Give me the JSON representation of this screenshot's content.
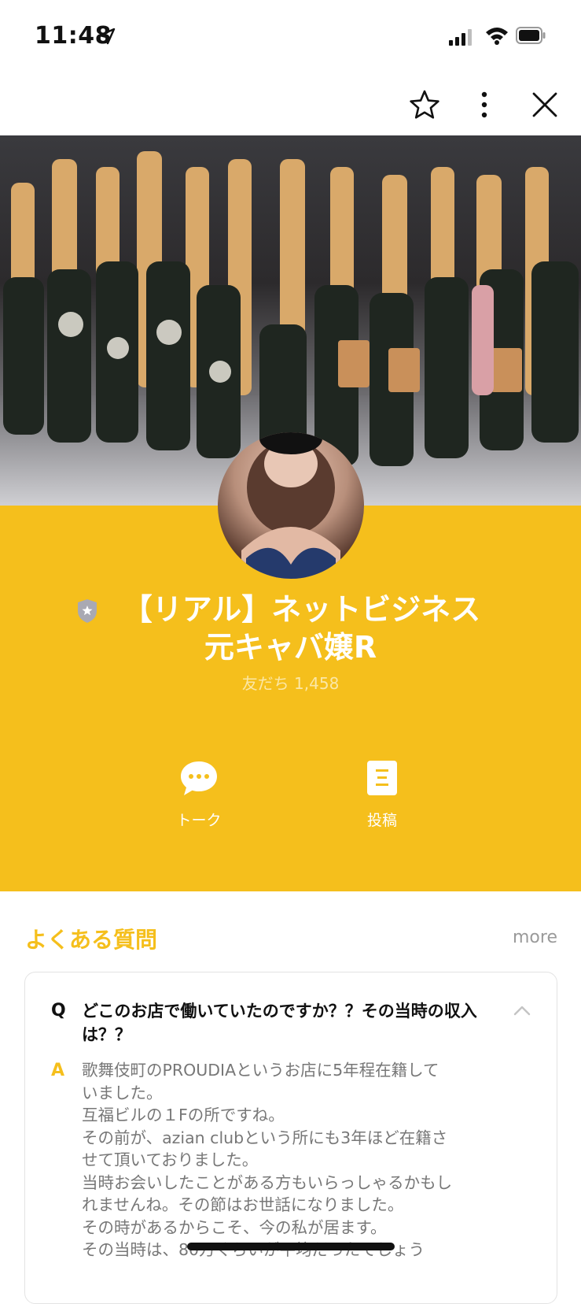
{
  "status_bar": {
    "time": "11:48"
  },
  "nav": {
    "icons": [
      "star-icon",
      "more-icon",
      "close-icon"
    ]
  },
  "profile": {
    "title_line1": "【リアル】ネットビジネス",
    "title_line2": "元キャバ嬢R",
    "friends": "友だち 1,458",
    "accent_color": "#f5bf1c"
  },
  "actions": [
    {
      "label": "トーク",
      "icon": "chat-icon"
    },
    {
      "label": "投稿",
      "icon": "post-icon"
    }
  ],
  "faq": {
    "title": "よくある質問",
    "more": "more",
    "q_mark": "Q",
    "question": "どこのお店で働いていたのですか？？その当時の収入は？？",
    "a_mark": "A",
    "answer_lines": [
      "歌舞伎町のPROUDIAというお店に5年程在籍して",
      "いました。",
      "互福ビルの１Fの所ですね。",
      "その前が、azian clubという所にも3年ほど在籍さ",
      "せて頂いておりました。",
      "当時お会いしたことがある方もいらっしゃるかもし",
      "れませんね。その節はお世話になりました。",
      "その時があるからこそ、今の私が居ます。",
      "その当時は、80万くらいが平均だったでしょう"
    ]
  }
}
